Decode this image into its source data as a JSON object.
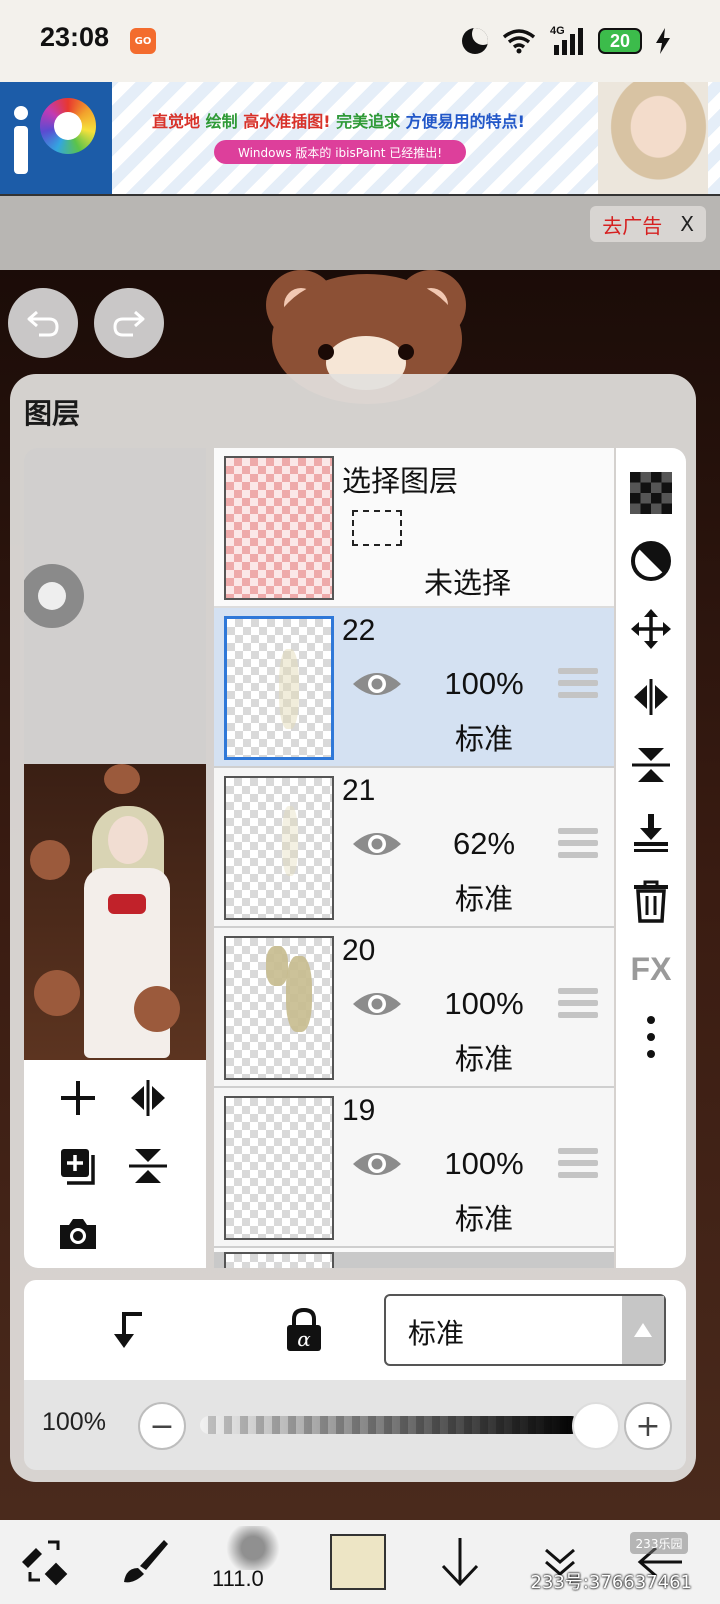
{
  "status_bar": {
    "time": "23:08",
    "app_badge": "GO",
    "network": "4G",
    "battery": "20"
  },
  "ad": {
    "headline_1": "直觉地",
    "headline_2": "绘制",
    "headline_3": "高水准插图!",
    "headline_4": "完美追求",
    "headline_5": "方便易用的特点!",
    "subline": "Windows 版本的 ibisPaint 已经推出!",
    "close_label": "去广告",
    "close_x": "X"
  },
  "panel": {
    "title": "图层",
    "selection_row": {
      "title": "选择图层",
      "state": "未选择"
    },
    "layers": [
      {
        "number": "22",
        "opacity": "100%",
        "mode": "标准",
        "active": true
      },
      {
        "number": "21",
        "opacity": "62%",
        "mode": "标准",
        "active": false
      },
      {
        "number": "20",
        "opacity": "100%",
        "mode": "标准",
        "active": false
      },
      {
        "number": "19",
        "opacity": "100%",
        "mode": "标准",
        "active": false
      }
    ],
    "blend_mode": "标准",
    "opacity_label": "100%",
    "opacity_value": 1.0,
    "fx_label": "FX"
  },
  "toolbar": {
    "brush_size": "111.0",
    "current_color": "#ede5c5"
  },
  "watermark": {
    "badge": "233乐园",
    "id_text": "233号:376637461"
  },
  "icons": [
    "undo-icon",
    "redo-icon",
    "add-layer-icon",
    "flip-horizontal-icon",
    "duplicate-layer-icon",
    "flip-vertical-icon",
    "camera-icon",
    "eye-icon",
    "checkerboard-icon",
    "clip-icon",
    "move-icon",
    "merge-down-icon",
    "trash-icon",
    "more-icon",
    "clipping-arrow-icon",
    "lock-alpha-icon",
    "minus-icon",
    "plus-icon",
    "tool-swap-icon",
    "brush-icon",
    "arrow-down-icon",
    "double-chevron-icon",
    "back-icon"
  ]
}
